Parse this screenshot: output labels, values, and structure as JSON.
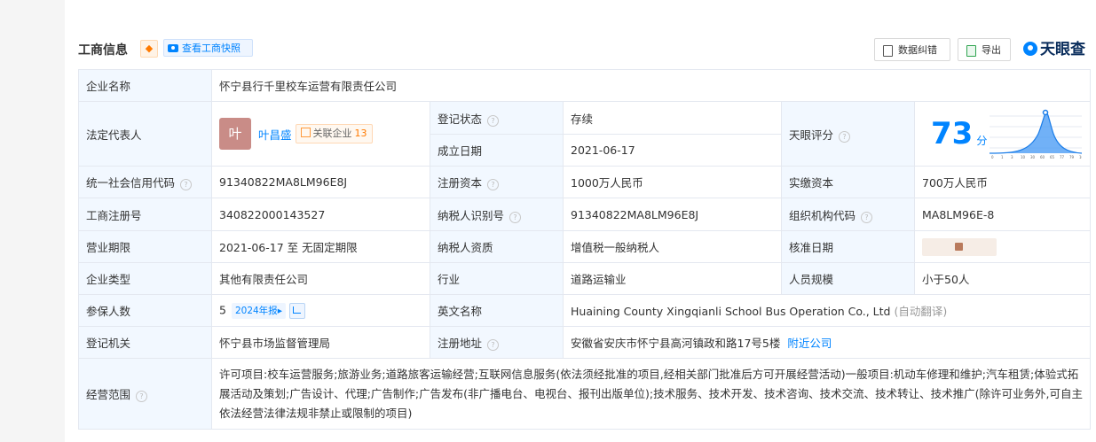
{
  "section": {
    "title": "工商信息",
    "snapshot_button": "查看工商快照",
    "correct_button": "数据纠错",
    "export_button": "导出",
    "logo_text": "天眼查"
  },
  "fields": {
    "company_name_label": "企业名称",
    "company_name": "怀宁县行千里校车运营有限责任公司",
    "legal_rep_label": "法定代表人",
    "legal_rep_avatar": "叶",
    "legal_rep_name": "叶昌盛",
    "related_label": "关联企业",
    "related_count": "13",
    "reg_status_label": "登记状态",
    "reg_status": "存续",
    "est_date_label": "成立日期",
    "est_date": "2021-06-17",
    "score_label": "天眼评分",
    "score": "73",
    "score_unit": "分",
    "credit_code_label": "统一社会信用代码",
    "credit_code": "91340822MA8LM96E8J",
    "reg_capital_label": "注册资本",
    "reg_capital": "1000万人民币",
    "paid_capital_label": "实缴资本",
    "paid_capital": "700万人民币",
    "biz_reg_no_label": "工商注册号",
    "biz_reg_no": "340822000143527",
    "taxpayer_id_label": "纳税人识别号",
    "taxpayer_id": "91340822MA8LM96E8J",
    "org_code_label": "组织机构代码",
    "org_code": "MA8LM96E-8",
    "term_label": "营业期限",
    "term": "2021-06-17 至 无固定期限",
    "taxpayer_qual_label": "纳税人资质",
    "taxpayer_qual": "增值税一般纳税人",
    "approve_date_label": "核准日期",
    "type_label": "企业类型",
    "type": "其他有限责任公司",
    "industry_label": "行业",
    "industry": "道路运输业",
    "staff_label": "人员规模",
    "staff": "小于50人",
    "insured_label": "参保人数",
    "insured": "5",
    "insured_year": "2024年报",
    "en_name_label": "英文名称",
    "en_name": "Huaining County Xingqianli School Bus Operation Co., Ltd",
    "en_name_note": "(自动翻译)",
    "authority_label": "登记机关",
    "authority": "怀宁县市场监督管理局",
    "address_label": "注册地址",
    "address": "安徽省安庆市怀宁县高河镇政和路17号5楼",
    "nearby": "附近公司",
    "scope_label": "经营范围",
    "scope": "许可项目:校车运营服务;旅游业务;道路旅客运输经营;互联网信息服务(依法须经批准的项目,经相关部门批准后方可开展经营活动)一般项目:机动车修理和维护;汽车租赁;体验式拓展活动及策划;广告设计、代理;广告制作;广告发布(非广播电台、电视台、报刊出版单位);技术服务、技术开发、技术咨询、技术交流、技术转让、技术推广(除许可业务外,可自主依法经营法律法规非禁止或限制的项目)"
  },
  "score_chart": {
    "ticks": [
      "0",
      "1",
      "3",
      "10",
      "30",
      "60",
      "65",
      "77",
      "79",
      "100"
    ]
  }
}
